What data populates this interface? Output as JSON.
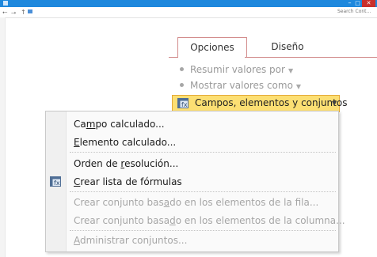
{
  "window": {
    "minimize_glyph": "–",
    "maximize_glyph": "□",
    "close_glyph": "✕"
  },
  "addressbar": {
    "back_glyph": "⭠",
    "forward_glyph": "⭢",
    "up_glyph": "↑",
    "search_placeholder": "Search Cont..."
  },
  "ribbon": {
    "tabs": [
      {
        "label": "Opciones"
      },
      {
        "label": "Diseño"
      }
    ],
    "items": [
      {
        "label": "Resumir valores por"
      },
      {
        "label": "Mostrar valores como"
      }
    ],
    "dropdown_button": {
      "label": "Campos, elementos y conjuntos",
      "icon": "pivot-table-icon"
    }
  },
  "menu": {
    "items": [
      {
        "pre": "Ca",
        "key": "m",
        "post": "po calculado...",
        "enabled": true
      },
      {
        "pre": "",
        "key": "E",
        "post": "lemento calculado...",
        "enabled": true
      },
      {
        "pre": "Orden de ",
        "key": "r",
        "post": "esolución...",
        "enabled": true
      },
      {
        "pre": "",
        "key": "C",
        "post": "rear lista de fórmulas",
        "enabled": true,
        "icon": "formula-list-icon"
      },
      {
        "pre": "Crear conjunto bas",
        "key": "a",
        "post": "do en los elementos de la fila...",
        "enabled": false
      },
      {
        "pre": "Crear conjunto basa",
        "key": "d",
        "post": "o en los elementos de la columna...",
        "enabled": false
      },
      {
        "pre": "",
        "key": "A",
        "post": "dministrar conjuntos...",
        "enabled": false
      }
    ]
  },
  "colors": {
    "titlebar": "#1e88dd",
    "close": "#c9302c",
    "button_fill": "#fcdf73",
    "button_border": "#e4a937",
    "tab_border": "#d28b8b",
    "disabled_text": "#a6a6a6"
  }
}
